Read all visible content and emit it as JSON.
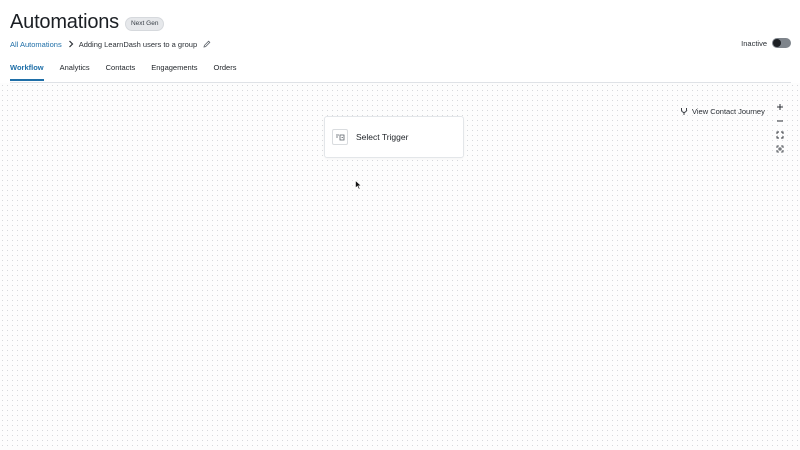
{
  "header": {
    "title": "Automations",
    "badge": "Next Gen"
  },
  "breadcrumb": {
    "parent": "All Automations",
    "current": "Adding LearnDash users to a group"
  },
  "status": {
    "label": "Inactive",
    "enabled": false
  },
  "tabs": [
    {
      "label": "Workflow",
      "active": true
    },
    {
      "label": "Analytics",
      "active": false
    },
    {
      "label": "Contacts",
      "active": false
    },
    {
      "label": "Engagements",
      "active": false
    },
    {
      "label": "Orders",
      "active": false
    }
  ],
  "canvas": {
    "journey_label": "View Contact Journey",
    "trigger_label": "Select Trigger",
    "zoom_controls": [
      "plus-icon",
      "minus-icon",
      "fit-view-icon",
      "fullscreen-icon"
    ]
  },
  "colors": {
    "accent": "#1f6fa8",
    "text": "#1f2328",
    "toggle_track": "#7e848b"
  }
}
